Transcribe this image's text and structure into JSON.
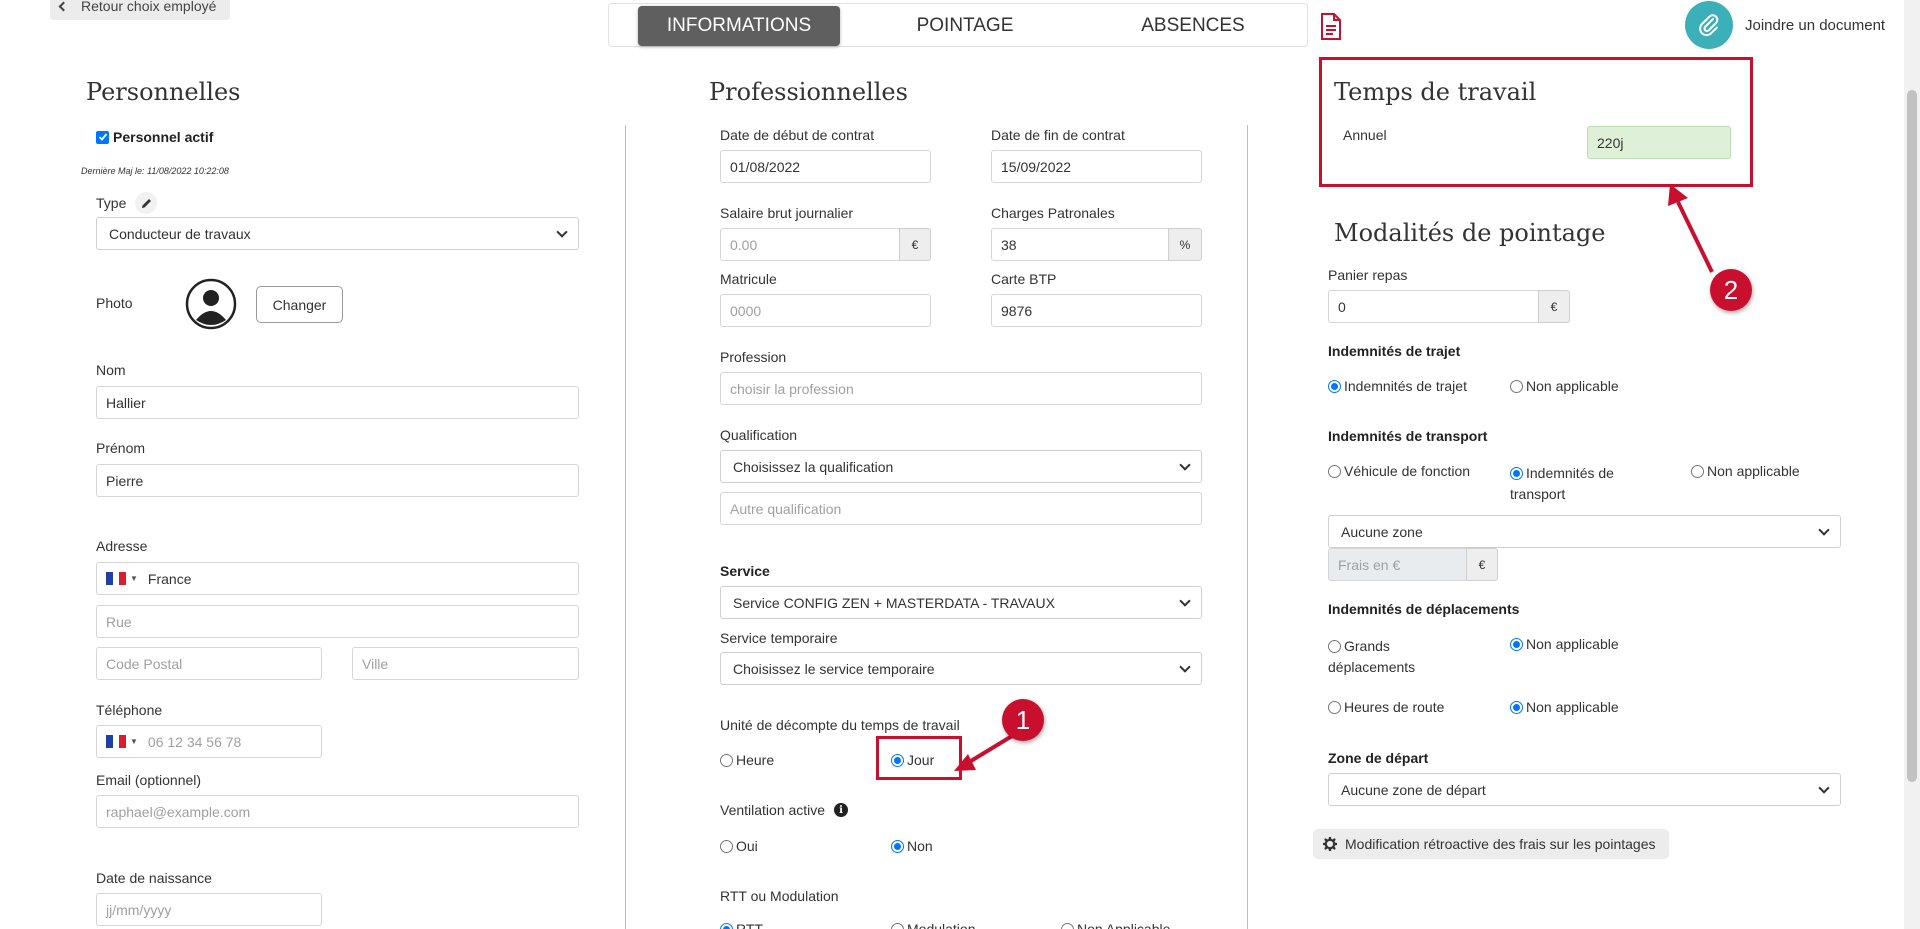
{
  "nav": {
    "back_label": "Retour choix employé",
    "tabs": [
      "INFORMATIONS",
      "POINTAGE",
      "ABSENCES"
    ],
    "attach_label": "Joindre un document"
  },
  "personal": {
    "title": "Personnelles",
    "active_label": "Personnel actif",
    "active_checked": true,
    "last_update": "Dernière Maj le: 11/08/2022 10:22:08",
    "type_label": "Type",
    "type_value": "Conducteur de travaux",
    "photo_label": "Photo",
    "change_button": "Changer",
    "nom_label": "Nom",
    "nom_value": "Hallier",
    "prenom_label": "Prénom",
    "prenom_value": "Pierre",
    "adresse_label": "Adresse",
    "country_value": "France",
    "rue_placeholder": "Rue",
    "cp_placeholder": "Code Postal",
    "ville_placeholder": "Ville",
    "phone_label": "Téléphone",
    "phone_placeholder": "06 12 34 56 78",
    "email_label": "Email (optionnel)",
    "email_placeholder": "raphael@example.com",
    "birth_label": "Date de naissance",
    "birth_placeholder": "jj/mm/yyyy"
  },
  "pro": {
    "title": "Professionnelles",
    "start_label": "Date de début de contrat",
    "start_value": "01/08/2022",
    "end_label": "Date de fin de contrat",
    "end_value": "15/09/2022",
    "salary_label": "Salaire brut journalier",
    "salary_placeholder": "0.00",
    "salary_unit": "€",
    "charges_label": "Charges Patronales",
    "charges_value": "38",
    "charges_unit": "%",
    "matricule_label": "Matricule",
    "matricule_placeholder": "0000",
    "btp_label": "Carte BTP",
    "btp_value": "9876",
    "profession_label": "Profession",
    "profession_placeholder": "choisir la profession",
    "qualif_label": "Qualification",
    "qualif_value": "Choisissez la qualification",
    "autre_qualif_placeholder": "Autre qualification",
    "service_label": "Service",
    "service_value": "Service CONFIG ZEN + MASTERDATA - TRAVAUX",
    "service_temp_label": "Service temporaire",
    "service_temp_value": "Choisissez le service temporaire",
    "unit_label": "Unité de décompte du temps de travail",
    "unit_heure": "Heure",
    "unit_jour": "Jour",
    "ventilation_label": "Ventilation active",
    "ventilation_oui": "Oui",
    "ventilation_non": "Non",
    "rtt_label": "RTT ou Modulation",
    "rtt_opt1": "RTT",
    "rtt_opt2": "Modulation",
    "rtt_opt3": "Non Applicable"
  },
  "work_time": {
    "title": "Temps de travail",
    "annual_label": "Annuel",
    "annual_value": "220j"
  },
  "pointage": {
    "title": "Modalités de pointage",
    "panier_label": "Panier repas",
    "panier_value": "0",
    "panier_unit": "€",
    "trajet_label": "Indemnités de trajet",
    "trajet_opt1": "Indemnités de trajet",
    "trajet_opt2": "Non applicable",
    "transport_label": "Indemnités de transport",
    "transport_opt1": "Véhicule de fonction",
    "transport_opt2_line1": "Indemnités de",
    "transport_opt2_line2": "transport",
    "transport_opt3": "Non applicable",
    "zone_value": "Aucune zone",
    "frais_placeholder": "Frais en €",
    "frais_unit": "€",
    "deplacement_label": "Indemnités de déplacements",
    "grands_line1": "Grands",
    "grands_line2": "déplacements",
    "grands_na": "Non applicable",
    "route_label": "Heures de route",
    "route_na": "Non applicable",
    "zone_depart_label": "Zone de départ",
    "zone_depart_value": "Aucune zone de départ",
    "retro_button": "Modification rétroactive des frais sur les pointages"
  },
  "annotations": {
    "marker1": "1",
    "marker2": "2",
    "color": "#c8102e"
  },
  "colors": {
    "active_tab_bg": "#5f5f5f",
    "accent_teal": "#3bb0b8",
    "annual_input_bg": "#dff0d8",
    "radio_blue": "#0075ff"
  },
  "icons": [
    "chevron-left-icon",
    "pdf-icon",
    "paperclip-icon",
    "pencil-icon",
    "avatar-icon",
    "info-icon",
    "gear-icon",
    "flag-fr-icon",
    "chevron-down-icon"
  ]
}
